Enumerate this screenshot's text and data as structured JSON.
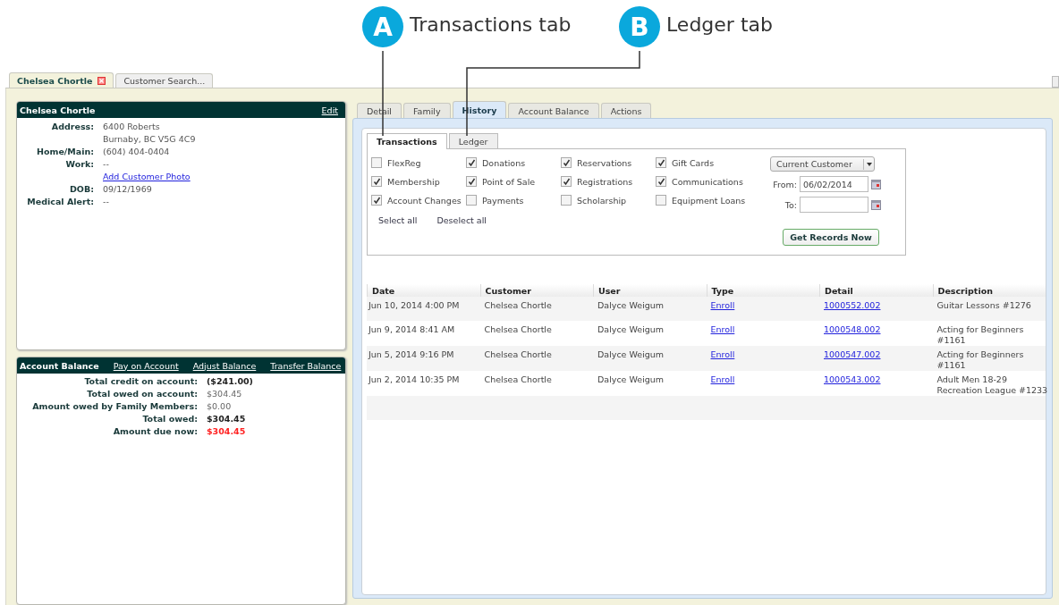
{
  "callouts": [
    {
      "badge": "A",
      "label": "Transactions tab"
    },
    {
      "badge": "B",
      "label": "Ledger tab"
    }
  ],
  "window_tabs": [
    {
      "label": "Chelsea Chortle",
      "selected": true,
      "closable": true
    },
    {
      "label": "Customer Search...",
      "selected": false,
      "closable": false
    }
  ],
  "customer_card": {
    "title": "Chelsea Chortle",
    "action": "Edit",
    "fields": [
      {
        "kind": "text",
        "label": "Address:",
        "values": [
          "6400 Roberts",
          "Burnaby, BC  V5G 4C9"
        ]
      },
      {
        "kind": "text",
        "label": "Home/Main:",
        "values": [
          "(604) 404-0404"
        ]
      },
      {
        "kind": "text",
        "label": "Work:",
        "values": [
          "--"
        ]
      },
      {
        "kind": "link",
        "values": [
          "Add Customer Photo"
        ]
      },
      {
        "kind": "text",
        "label": "DOB:",
        "values": [
          "09/12/1969"
        ]
      },
      {
        "kind": "text",
        "label": "Medical Alert:",
        "values": [
          "--"
        ]
      }
    ]
  },
  "account_card": {
    "title": "Account Balance",
    "links": [
      "Pay on Account",
      "Adjust Balance",
      "Transfer Balance"
    ],
    "rows": [
      {
        "label": "Total credit on account:",
        "value": "($241.00)",
        "bold": true,
        "alert": false
      },
      {
        "label": "Total owed on account:",
        "value": "$304.45",
        "bold": false,
        "alert": false
      },
      {
        "label": "Amount owed by Family Members:",
        "value": "$0.00",
        "bold": false,
        "alert": false
      },
      {
        "label": "Total owed:",
        "value": "$304.45",
        "bold": true,
        "alert": false
      },
      {
        "label": "Amount due now:",
        "value": "$304.45",
        "bold": true,
        "alert": true
      }
    ]
  },
  "detail_tabs": [
    {
      "label": "Detail",
      "selected": false
    },
    {
      "label": "Family",
      "selected": false
    },
    {
      "label": "History",
      "selected": true
    },
    {
      "label": "Account Balance",
      "selected": false
    },
    {
      "label": "Actions",
      "selected": false
    }
  ],
  "history_tabs": [
    {
      "label": "Transactions",
      "selected": true
    },
    {
      "label": "Ledger",
      "selected": false
    }
  ],
  "filters": [
    {
      "label": "FlexReg",
      "checked": false
    },
    {
      "label": "Donations",
      "checked": true
    },
    {
      "label": "Reservations",
      "checked": true
    },
    {
      "label": "Gift Cards",
      "checked": true
    },
    {
      "label": "Membership",
      "checked": true
    },
    {
      "label": "Point of Sale",
      "checked": true
    },
    {
      "label": "Registrations",
      "checked": true
    },
    {
      "label": "Communications",
      "checked": true
    },
    {
      "label": "Account Changes",
      "checked": true
    },
    {
      "label": "Payments",
      "checked": false
    },
    {
      "label": "Scholarship",
      "checked": false
    },
    {
      "label": "Equipment Loans",
      "checked": false
    }
  ],
  "select_links": [
    "Select all",
    "Deselect all"
  ],
  "customer_select": {
    "value": "Current Customer"
  },
  "date_from": {
    "label": "From:",
    "value": "06/02/2014"
  },
  "date_to": {
    "label": "To:"
  },
  "get_button": "Get Records Now",
  "table": {
    "columns": [
      "Date",
      "Customer",
      "User",
      "Type",
      "Detail",
      "Description"
    ],
    "rows": [
      {
        "date": "Jun 10, 2014 4:00 PM",
        "customer": "Chelsea Chortle",
        "user": "Dalyce Weigum",
        "type": "Enroll",
        "detail": "1000552.002",
        "description": [
          "Guitar Lessons #1276"
        ]
      },
      {
        "date": "Jun 9, 2014 8:41 AM",
        "customer": "Chelsea Chortle",
        "user": "Dalyce Weigum",
        "type": "Enroll",
        "detail": "1000548.002",
        "description": [
          "Acting for Beginners",
          "#1161"
        ]
      },
      {
        "date": "Jun 5, 2014 9:16 PM",
        "customer": "Chelsea Chortle",
        "user": "Dalyce Weigum",
        "type": "Enroll",
        "detail": "1000547.002",
        "description": [
          "Acting for Beginners",
          "#1161"
        ]
      },
      {
        "date": "Jun 2, 2014 10:35 PM",
        "customer": "Chelsea Chortle",
        "user": "Dalyce Weigum",
        "type": "Enroll",
        "detail": "1000543.002",
        "description": [
          "Adult Men 18-29",
          "Recreation League #1233"
        ]
      }
    ]
  }
}
